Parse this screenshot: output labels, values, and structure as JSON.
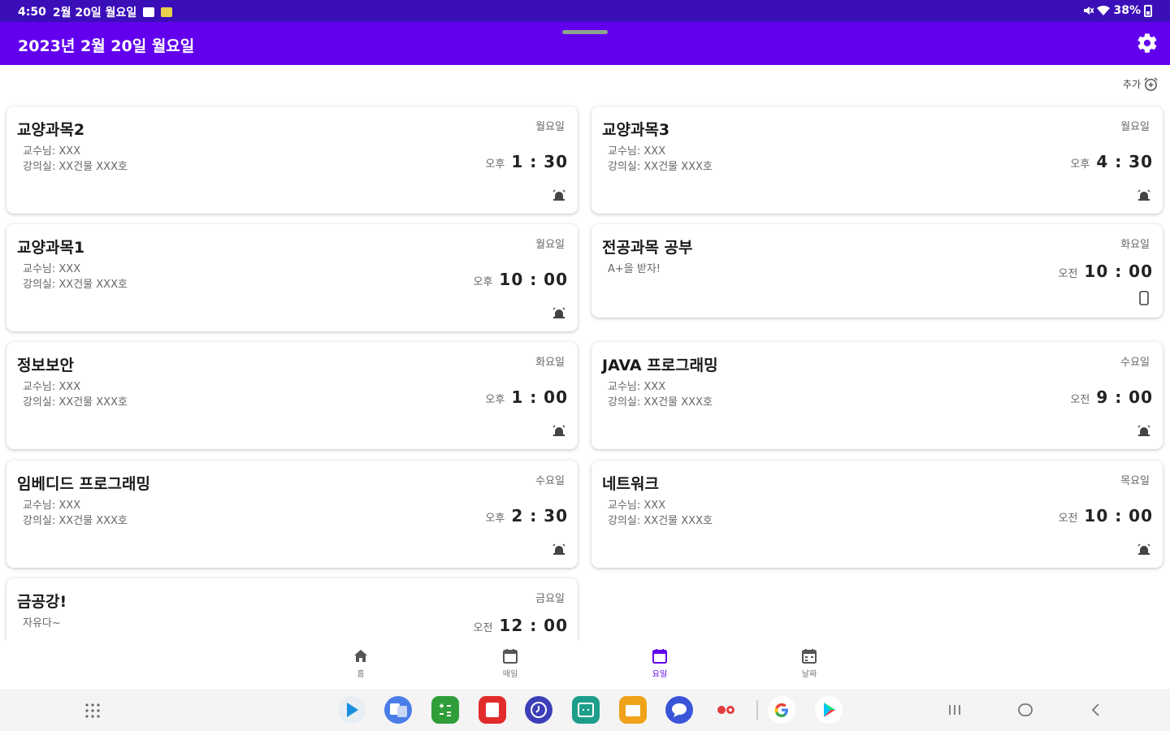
{
  "status_bar": {
    "time": "4:50",
    "date": "2월 20일 월요일",
    "battery": "38%"
  },
  "app_bar": {
    "title": "2023년 2월 20일 월요일"
  },
  "add_button": {
    "label": "추가"
  },
  "cards": [
    {
      "title": "교양과목2",
      "day": "월요일",
      "desc": "교수님: XXX\n강의실: XX건물 XXX호",
      "ampm": "오후",
      "time": "1 : 30",
      "icon": "alarm-icon"
    },
    {
      "title": "교양과목3",
      "day": "월요일",
      "desc": "교수님: XXX\n강의실: XX건물 XXX호",
      "ampm": "오후",
      "time": "4 : 30",
      "icon": "alarm-icon"
    },
    {
      "title": "교양과목1",
      "day": "월요일",
      "desc": "교수님: XXX\n강의실: XX건물 XXX호",
      "ampm": "오후",
      "time": "10 : 00",
      "icon": "alarm-icon"
    },
    {
      "title": "전공과목 공부",
      "day": "화요일",
      "desc": "A+을 받자!",
      "ampm": "오전",
      "time": "10 : 00",
      "icon": "phone-icon"
    },
    {
      "title": "정보보안",
      "day": "화요일",
      "desc": "교수님: XXX\n강의실: XX건물 XXX호",
      "ampm": "오후",
      "time": "1 : 00",
      "icon": "alarm-icon"
    },
    {
      "title": "JAVA 프로그래밍",
      "day": "수요일",
      "desc": "교수님: XXX\n강의실: XX건물 XXX호",
      "ampm": "오전",
      "time": "9 : 00",
      "icon": "alarm-icon"
    },
    {
      "title": "임베디드 프로그래밍",
      "day": "수요일",
      "desc": "교수님: XXX\n강의실: XX건물 XXX호",
      "ampm": "오후",
      "time": "2 : 30",
      "icon": "alarm-icon"
    },
    {
      "title": "네트워크",
      "day": "목요일",
      "desc": "교수님: XXX\n강의실: XX건물 XXX호",
      "ampm": "오전",
      "time": "10 : 00",
      "icon": "alarm-icon"
    },
    {
      "title": "금공강!",
      "day": "금요일",
      "desc": "자유다~",
      "ampm": "오전",
      "time": "12 : 00",
      "icon": "alarm-icon"
    }
  ],
  "bottom_nav": [
    {
      "label": "홈",
      "icon": "home-icon",
      "active": false
    },
    {
      "label": "매일",
      "icon": "calendar-icon",
      "active": false
    },
    {
      "label": "요일",
      "icon": "calendar-icon",
      "active": true
    },
    {
      "label": "날짜",
      "icon": "calendar-grid-icon",
      "active": false
    }
  ],
  "colors": {
    "status_bar": "#3a0fb8",
    "app_bar": "#6200ee",
    "active_nav": "#6200ee"
  },
  "dock_apps": [
    "play-store-icon",
    "translate-icon",
    "calculator-icon",
    "notes-icon",
    "clock-icon",
    "calendar-app-icon",
    "folder-icon",
    "messages-icon",
    "camera-icon",
    "google-icon",
    "play-games-icon"
  ]
}
